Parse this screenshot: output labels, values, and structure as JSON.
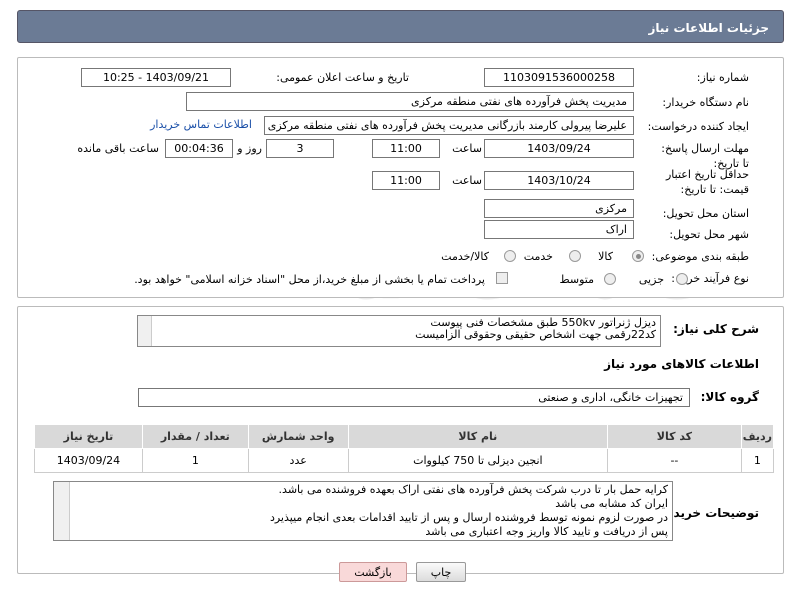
{
  "header": {
    "title": "جزئیات اطلاعات نیاز"
  },
  "form": {
    "need_number_label": "شماره نیاز:",
    "need_number": "1103091536000258",
    "announce_label": "تاریخ و ساعت اعلان عمومی:",
    "announce_value": "1403/09/21 - 10:25",
    "buyer_org_label": "نام دستگاه خریدار:",
    "buyer_org": "مدیریت پخش فرآورده های نفتی منطقه مرکزی",
    "requester_label": "ایجاد کننده درخواست:",
    "requester": "علیرضا پیرولی کارمند بازرگانی مدیریت پخش فرآورده های نفتی منطقه مرکزی",
    "contact_link": "اطلاعات تماس خریدار",
    "deadline_label": "مهلت ارسال پاسخ: تا تاریخ:",
    "deadline_date": "1403/09/24",
    "time_label": "ساعت",
    "deadline_time": "11:00",
    "days_value": "3",
    "days_label": "روز و",
    "remaining_time": "00:04:36",
    "remaining_label": "ساعت باقی مانده",
    "validity_label": "حداقل تاریخ اعتبار قیمت: تا تاریخ:",
    "validity_date": "1403/10/24",
    "validity_time": "11:00",
    "province_label": "استان محل تحویل:",
    "province": "مرکزی",
    "city_label": "شهر محل تحویل:",
    "city": "اراک",
    "category_label": "طبقه بندی موضوعی:",
    "category_options": [
      "کالا",
      "خدمت",
      "کالا/خدمت"
    ],
    "purchase_type_label": "نوع فرآیند خرید :",
    "purchase_options": [
      "جزیی",
      "متوسط"
    ],
    "payment_note": "پرداخت تمام یا بخشی از مبلغ خرید،از محل \"اسناد خزانه اسلامی\" خواهد بود."
  },
  "description": {
    "label": "شرح کلی نیاز:",
    "line1": "دیزل ژنراتور 550kv  طبق مشخصات فنی پیوست",
    "line2": "کد22رقمی  جهت اشخاص حقیقی وحقوقی الزامیست"
  },
  "goods_info": {
    "title": "اطلاعات کالاهای مورد نیاز",
    "group_label": "گروه کالا:",
    "group_value": "تجهیزات خانگی، اداری و صنعتی"
  },
  "table": {
    "headers": [
      "ردیف",
      "کد کالا",
      "نام کالا",
      "واحد شمارش",
      "تعداد / مقدار",
      "تاریخ نیاز"
    ],
    "rows": [
      [
        "1",
        "--",
        "انجین دیزلی تا 750 کیلووات",
        "عدد",
        "1",
        "1403/09/24"
      ]
    ]
  },
  "buyer_notes": {
    "label": "توضیحات خریدار:",
    "line1": "کرایه حمل بار تا درب شرکت  پخش فرآورده های نفتی اراک بعهده فروشنده می باشد.",
    "line2": "ایران کد مشابه می باشد",
    "line3": "در صورت لزوم نمونه توسط فروشنده ارسال و پس از تایید اقدامات بعدی انجام میپذیرد",
    "line4": "پس از دریافت و تایید کالا واریز وجه اعتباری می باشد"
  },
  "buttons": {
    "print": "چاپ",
    "back": "بازگشت"
  },
  "colors": {
    "header_bg": "#6b7b95",
    "link": "#1a4fa8",
    "back_btn_bg": "#f9d9d9"
  }
}
